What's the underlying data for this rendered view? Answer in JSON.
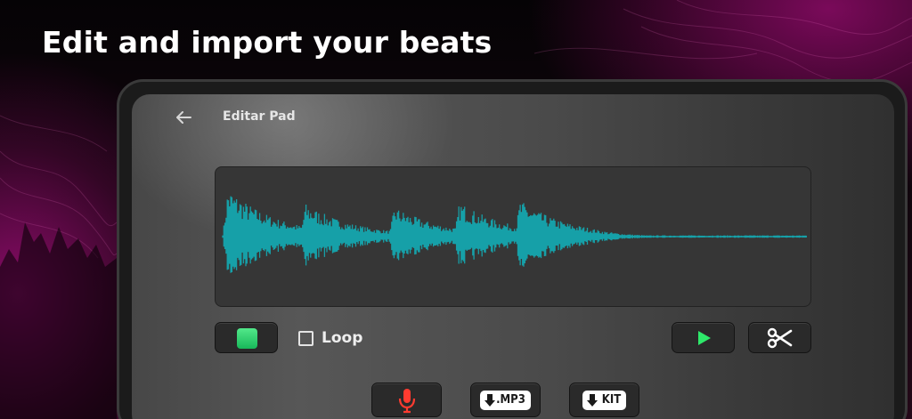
{
  "headline": "Edit and import your beats",
  "screen": {
    "title": "Editar Pad",
    "back_icon": "arrow-left-icon",
    "waveform_color": "#16a0a8"
  },
  "controls": {
    "pad_color": "#22c468",
    "loop_label": "Loop",
    "loop_checked": false,
    "play_icon": "play-icon",
    "play_color": "#2ee86a",
    "cut_icon": "scissors-icon"
  },
  "bottom_buttons": {
    "mic_icon": "microphone-icon",
    "mic_color": "#ff3b30",
    "mp3_label": ".MP3",
    "kit_label": "KIT"
  }
}
